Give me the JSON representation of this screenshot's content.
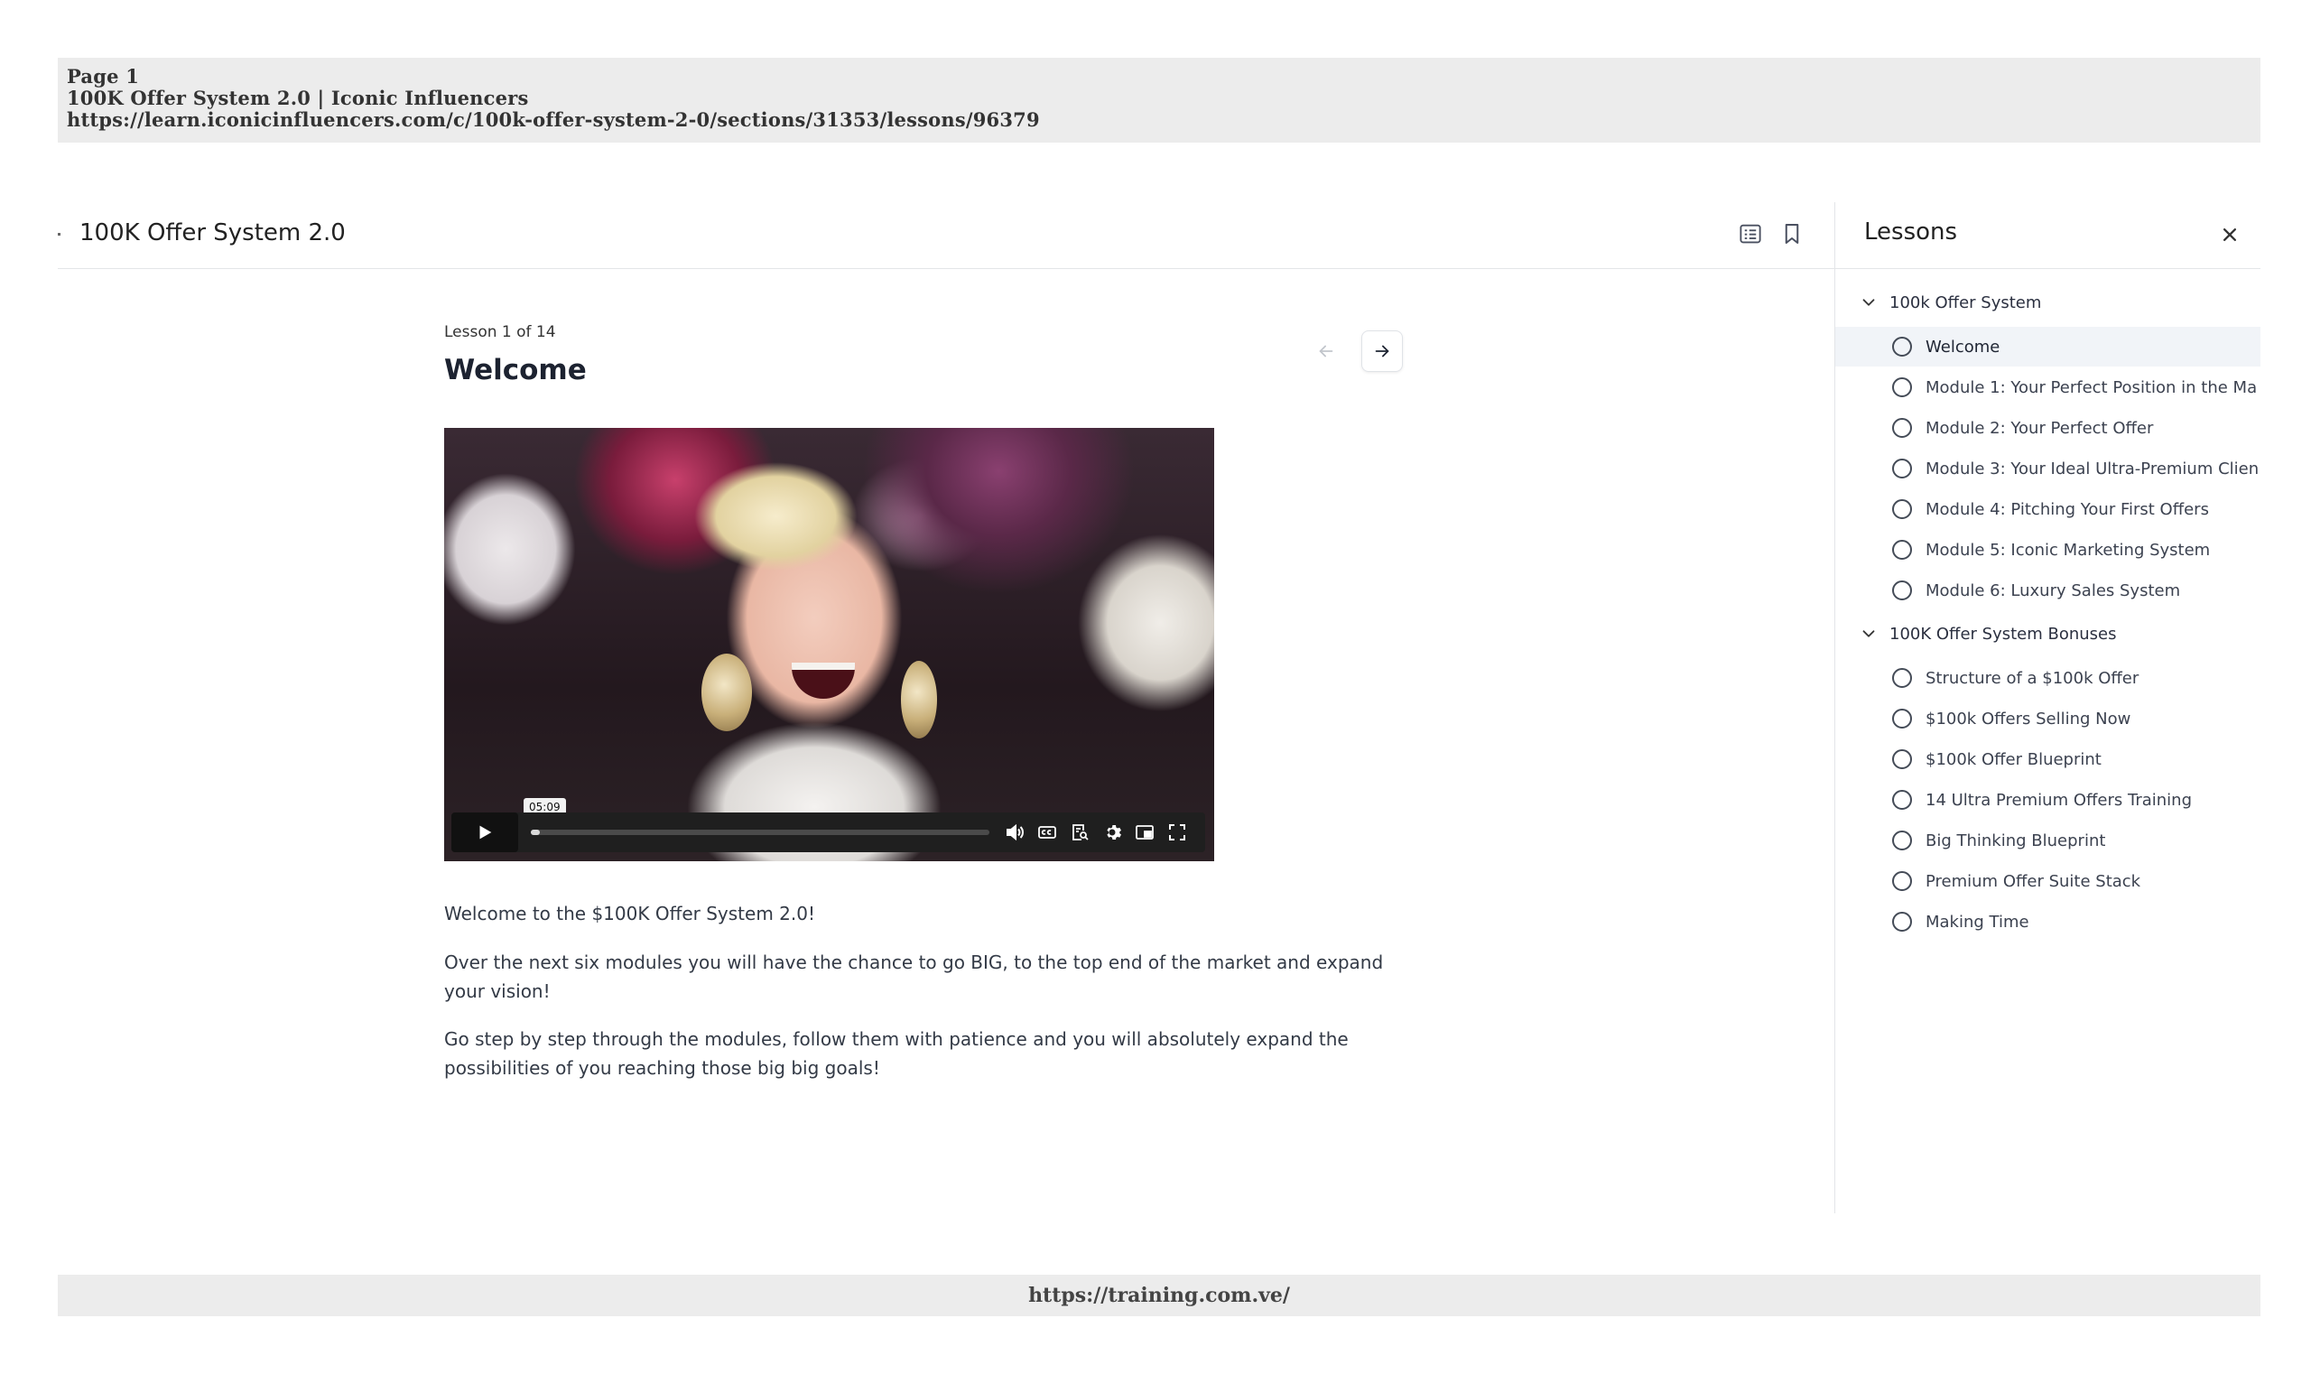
{
  "print_header": {
    "page": "Page 1",
    "title": "100K Offer System 2.0 | Iconic Influencers",
    "url": "https://learn.iconicinfluencers.com/c/100k-offer-system-2-0/sections/31353/lessons/96379"
  },
  "print_footer": {
    "url": "https://training.com.ve/"
  },
  "topbar": {
    "course_title": "100K Offer System 2.0"
  },
  "lesson": {
    "meta": "Lesson 1 of 14",
    "title": "Welcome",
    "video": {
      "time_tooltip": "05:09",
      "progress_fraction": 0.02
    },
    "paragraphs": [
      "Welcome to the $100K Offer System 2.0!",
      "Over the next six modules you will have the chance to go BIG, to the top end of the market and expand your vision!",
      "Go step by step through the modules, follow them with patience and you will absolutely expand the possibilities of you reaching those big big goals!"
    ]
  },
  "sidebar": {
    "title": "Lessons",
    "sections": [
      {
        "label": "100k Offer System",
        "lessons": [
          "Welcome",
          "Module 1: Your Perfect Position in the Ma",
          "Module 2: Your Perfect Offer",
          "Module 3: Your Ideal Ultra-Premium Clien",
          "Module 4: Pitching Your First Offers",
          "Module 5: Iconic Marketing System",
          "Module 6: Luxury Sales System"
        ]
      },
      {
        "label": "100K Offer System Bonuses",
        "lessons": [
          "Structure of a $100k Offer",
          "$100k Offers Selling Now",
          "$100k Offer Blueprint",
          "14 Ultra Premium Offers Training",
          "Big Thinking Blueprint",
          "Premium Offer Suite Stack",
          "Making Time"
        ]
      }
    ],
    "active_lesson": "Welcome"
  },
  "icons": {
    "notes": "notes-icon",
    "bookmark": "bookmark-icon",
    "close": "close-icon",
    "chevron": "chevron-down-icon",
    "prev": "arrow-left-icon",
    "next": "arrow-right-icon"
  }
}
